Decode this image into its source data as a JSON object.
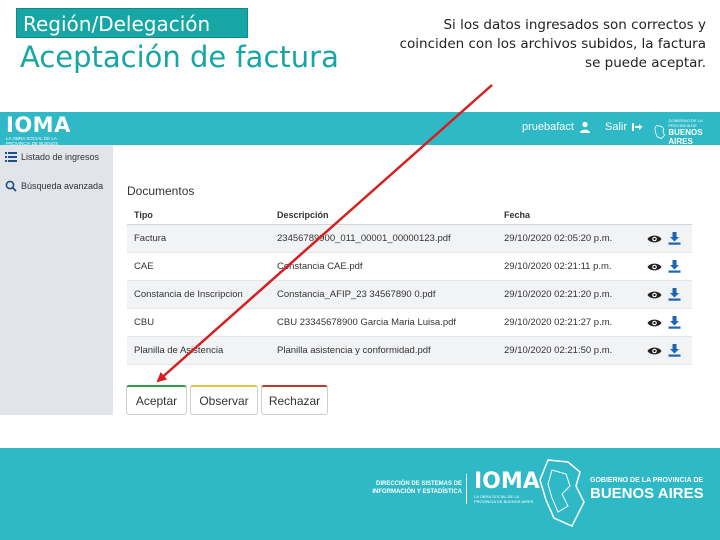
{
  "slide": {
    "region": "Región/Delegación",
    "title": "Aceptación de factura",
    "note": "Si los datos ingresados son correctos y coinciden con los archivos subidos, la factura se puede aceptar."
  },
  "header": {
    "logo": "IOMA",
    "logo_sub": "LA OBRA SOCIAL DE LA PROVINCIA DE BUENOS AIRES",
    "username": "pruebafact",
    "exit_label": "Salir",
    "gov_line1": "GOBIERNO DE LA PROVINCIA DE",
    "gov_line2": "BUENOS AIRES"
  },
  "sidebar": {
    "items": [
      {
        "label": "Listado de ingresos",
        "icon": "list-icon"
      },
      {
        "label": "Búsqueda avanzada",
        "icon": "search-icon"
      }
    ]
  },
  "documents": {
    "title": "Documentos",
    "columns": [
      "Tipo",
      "Descripción",
      "Fecha"
    ],
    "rows": [
      {
        "tipo": "Factura",
        "descripcion": "23456789900_011_00001_00000123.pdf",
        "fecha": "29/10/2020 02:05:20 p.m."
      },
      {
        "tipo": "CAE",
        "descripcion": "Constancia CAE.pdf",
        "fecha": "29/10/2020 02:21:11 p.m."
      },
      {
        "tipo": "Constancia de Inscripcion",
        "descripcion": "Constancia_AFIP_23 34567890 0.pdf",
        "fecha": "29/10/2020 02:21:20 p.m."
      },
      {
        "tipo": "CBU",
        "descripcion": "CBU 23345678900 Garcia Maria Luisa.pdf",
        "fecha": "29/10/2020 02:21:27 p.m."
      },
      {
        "tipo": "Planilla de Asistencia",
        "descripcion": "Planilla asistencia y conformidad.pdf",
        "fecha": "29/10/2020 02:21:50 p.m."
      }
    ]
  },
  "actions": {
    "accept": "Aceptar",
    "observe": "Observar",
    "reject": "Rechazar"
  },
  "footer": {
    "direccion": "DIRECCIÓN DE SISTEMAS DE INFORMACIÓN Y ESTADÍSTICA",
    "ioma": "IOMA",
    "ioma_sub": "LA OBRA SOCIAL DE LA PROVINCIA DE BUENOS AIRES",
    "gov_line1": "GOBIERNO DE LA PROVINCIA DE",
    "gov_line2": "BUENOS AIRES"
  },
  "colors": {
    "brand": "#2fb9c6",
    "title": "#17a6a6",
    "accept_accent": "#2e9e4a",
    "observe_accent": "#e8c23a",
    "reject_accent": "#c0392b",
    "icon_blue": "#1f64b4",
    "arrow": "#d42020"
  }
}
